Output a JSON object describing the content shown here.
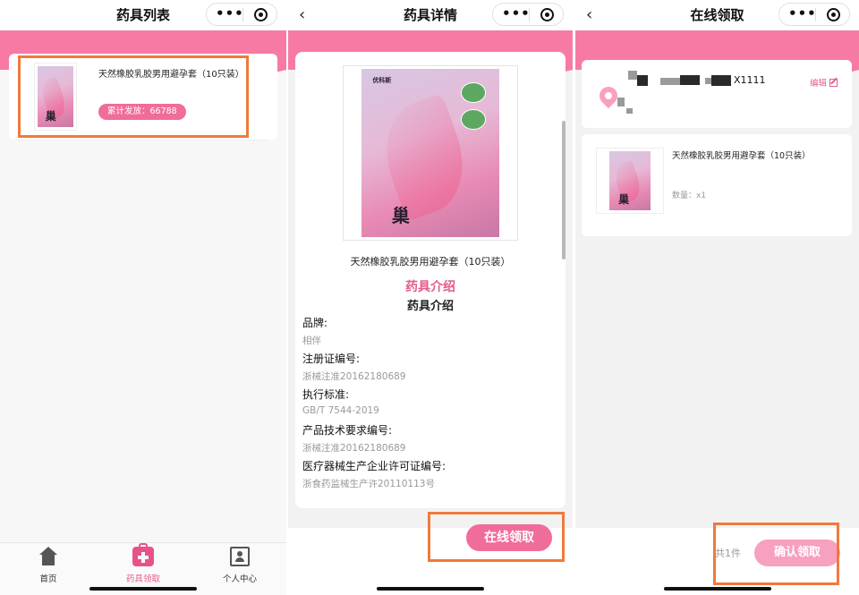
{
  "panel_list": {
    "title": "药具列表",
    "item": {
      "name": "天然橡胶乳胶男用避孕套（10只装）",
      "count_label": "累计发放：66788"
    },
    "tabs": [
      {
        "label": "首页",
        "icon": "home-icon",
        "active": false
      },
      {
        "label": "药具领取",
        "icon": "medical-kit-icon",
        "active": true
      },
      {
        "label": "个人中心",
        "icon": "user-contacts-icon",
        "active": false
      }
    ]
  },
  "panel_detail": {
    "title": "药具详情",
    "product_name": "天然橡胶乳胶男用避孕套（10只装）",
    "intro_heading_pink": "药具介绍",
    "intro_heading": "药具介绍",
    "attributes": [
      {
        "key": "品牌:",
        "value": "相伴"
      },
      {
        "key": "注册证编号:",
        "value": "浙械注准20162180689"
      },
      {
        "key": "执行标准:",
        "value": "GB/T 7544-2019"
      },
      {
        "key": "产品技术要求编号:",
        "value": "浙械注准20162180689"
      },
      {
        "key": "医疗器械生产企业许可证编号:",
        "value": "浙食药监械生产许20110113号"
      }
    ],
    "claim_button": "在线领取",
    "box_brand": "优科斯",
    "box_glyph": "巢"
  },
  "panel_claim": {
    "title": "在线领取",
    "address_tail": "X1111",
    "edit_label": "编辑",
    "order": {
      "name": "天然橡胶乳胶男用避孕套（10只装）",
      "quantity": "数量：x1"
    },
    "total": "共1件",
    "confirm_button": "确认领取"
  },
  "colors": {
    "accent": "#f06c9b",
    "banner": "#f77aa5",
    "highlight": "#ee7a3c"
  }
}
